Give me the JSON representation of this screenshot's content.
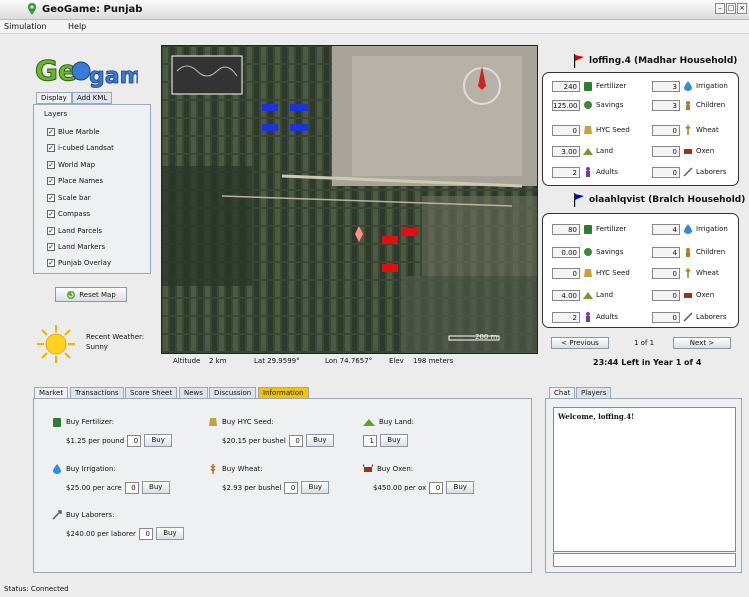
{
  "window": {
    "title": "GeoGame: Punjab"
  },
  "menu": [
    "Simulation",
    "Help"
  ],
  "left": {
    "tabs": [
      "Display",
      "Add KML"
    ],
    "layers_title": "Layers",
    "layers": [
      "Blue Marble",
      "i-cubed Landsat",
      "World Map",
      "Place Names",
      "Scale bar",
      "Compass",
      "Land Parcels",
      "Land Markers",
      "Punjab Overlay"
    ],
    "reset_label": "Reset Map",
    "weather_label": "Recent Weather:",
    "weather_value": "Sunny"
  },
  "map": {
    "altitude_label": "Altitude",
    "altitude": "2 km",
    "lat": "Lat 29.9599°",
    "lon": "Lon 74.7657°",
    "elev_label": "Elev",
    "elev": "198 meters",
    "scale": "200 m"
  },
  "households": [
    {
      "title": "loffing.4 (Madhar Household)",
      "flag_color": "#e00000",
      "left": [
        {
          "v": "240",
          "l": "Fertilizer"
        },
        {
          "v": "125.00",
          "l": "Savings"
        },
        {
          "v": "0",
          "l": "HYC Seed"
        },
        {
          "v": "3.00",
          "l": "Land"
        },
        {
          "v": "2",
          "l": "Adults"
        }
      ],
      "right": [
        {
          "v": "3",
          "l": "Irrigation"
        },
        {
          "v": "3",
          "l": "Children"
        },
        {
          "v": "0",
          "l": "Wheat"
        },
        {
          "v": "0",
          "l": "Oxen"
        },
        {
          "v": "0",
          "l": "Laborers"
        }
      ]
    },
    {
      "title": "olaahlqvist (Bralch Household)",
      "flag_color": "#0000dd",
      "left": [
        {
          "v": "80",
          "l": "Fertilizer"
        },
        {
          "v": "0.00",
          "l": "Savings"
        },
        {
          "v": "0",
          "l": "HYC Seed"
        },
        {
          "v": "4.00",
          "l": "Land"
        },
        {
          "v": "2",
          "l": "Adults"
        }
      ],
      "right": [
        {
          "v": "4",
          "l": "Irrigation"
        },
        {
          "v": "4",
          "l": "Children"
        },
        {
          "v": "0",
          "l": "Wheat"
        },
        {
          "v": "0",
          "l": "Oxen"
        },
        {
          "v": "0",
          "l": "Laborers"
        }
      ]
    }
  ],
  "nav": {
    "prev": "< Previous",
    "page": "1 of 1",
    "next": "Next >",
    "time": "23:44 Left in Year 1 of 4"
  },
  "bottom_tabs": [
    "Market",
    "Transactions",
    "Score Sheet",
    "News",
    "Discussion",
    "Information"
  ],
  "market": {
    "fert": {
      "title": "Buy Fertilizer:",
      "price": "$1.25 per pound",
      "qty": "0",
      "btn": "Buy"
    },
    "seed": {
      "title": "Buy HYC Seed:",
      "price": "$20.15 per bushel",
      "qty": "0",
      "btn": "Buy"
    },
    "land": {
      "title": "Buy Land:",
      "qty": "1",
      "btn": "Buy"
    },
    "irr": {
      "title": "Buy Irrigation:",
      "price": "$25.00 per acre",
      "qty": "0",
      "btn": "Buy"
    },
    "wheat": {
      "title": "Buy Wheat:",
      "price": "$2.93 per bushel",
      "qty": "0",
      "btn": "Buy"
    },
    "oxen": {
      "title": "Buy Oxen:",
      "price": "$450.00 per ox",
      "qty": "0",
      "btn": "Buy"
    },
    "lab": {
      "title": "Buy Laborers:",
      "price": "$240.00 per laborer",
      "qty": "0",
      "btn": "Buy"
    }
  },
  "chat": {
    "tabs": [
      "Chat",
      "Players"
    ],
    "message": "Welcome, loffing.4!"
  },
  "status": "Status: Connected",
  "colors": {
    "accent_tab": "#f5c400",
    "red_flag": "#e00000",
    "blue_flag": "#0000dd"
  }
}
